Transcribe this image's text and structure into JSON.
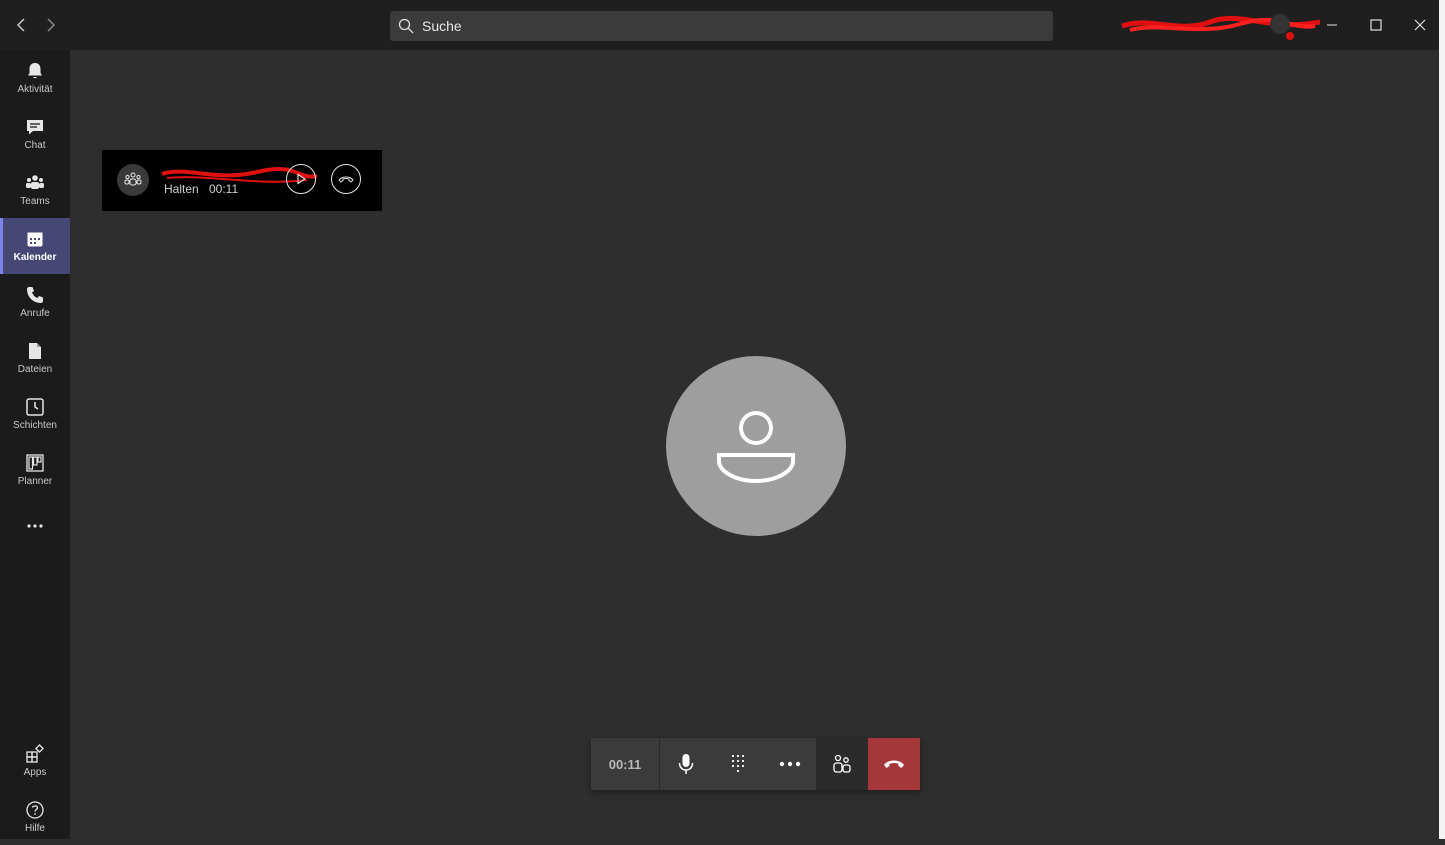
{
  "titlebar": {
    "search_placeholder": "Suche"
  },
  "rail": {
    "items": [
      {
        "label": "Aktivität",
        "icon": "bell-icon"
      },
      {
        "label": "Chat",
        "icon": "chat-icon"
      },
      {
        "label": "Teams",
        "icon": "teams-icon"
      },
      {
        "label": "Kalender",
        "icon": "calendar-icon",
        "active": true
      },
      {
        "label": "Anrufe",
        "icon": "phone-icon"
      },
      {
        "label": "Dateien",
        "icon": "file-icon"
      },
      {
        "label": "Schichten",
        "icon": "clock-icon"
      },
      {
        "label": "Planner",
        "icon": "planner-icon"
      },
      {
        "label": "...",
        "icon": "more-icon"
      }
    ],
    "bottom": [
      {
        "label": "Apps",
        "icon": "apps-icon"
      },
      {
        "label": "Hilfe",
        "icon": "help-icon"
      }
    ]
  },
  "held_call": {
    "status": "Halten",
    "duration": "00:11"
  },
  "call_controls": {
    "duration": "00:11"
  },
  "colors": {
    "accent": "#464775",
    "hangup": "#a4373a",
    "avatar": "#9e9e9e"
  }
}
